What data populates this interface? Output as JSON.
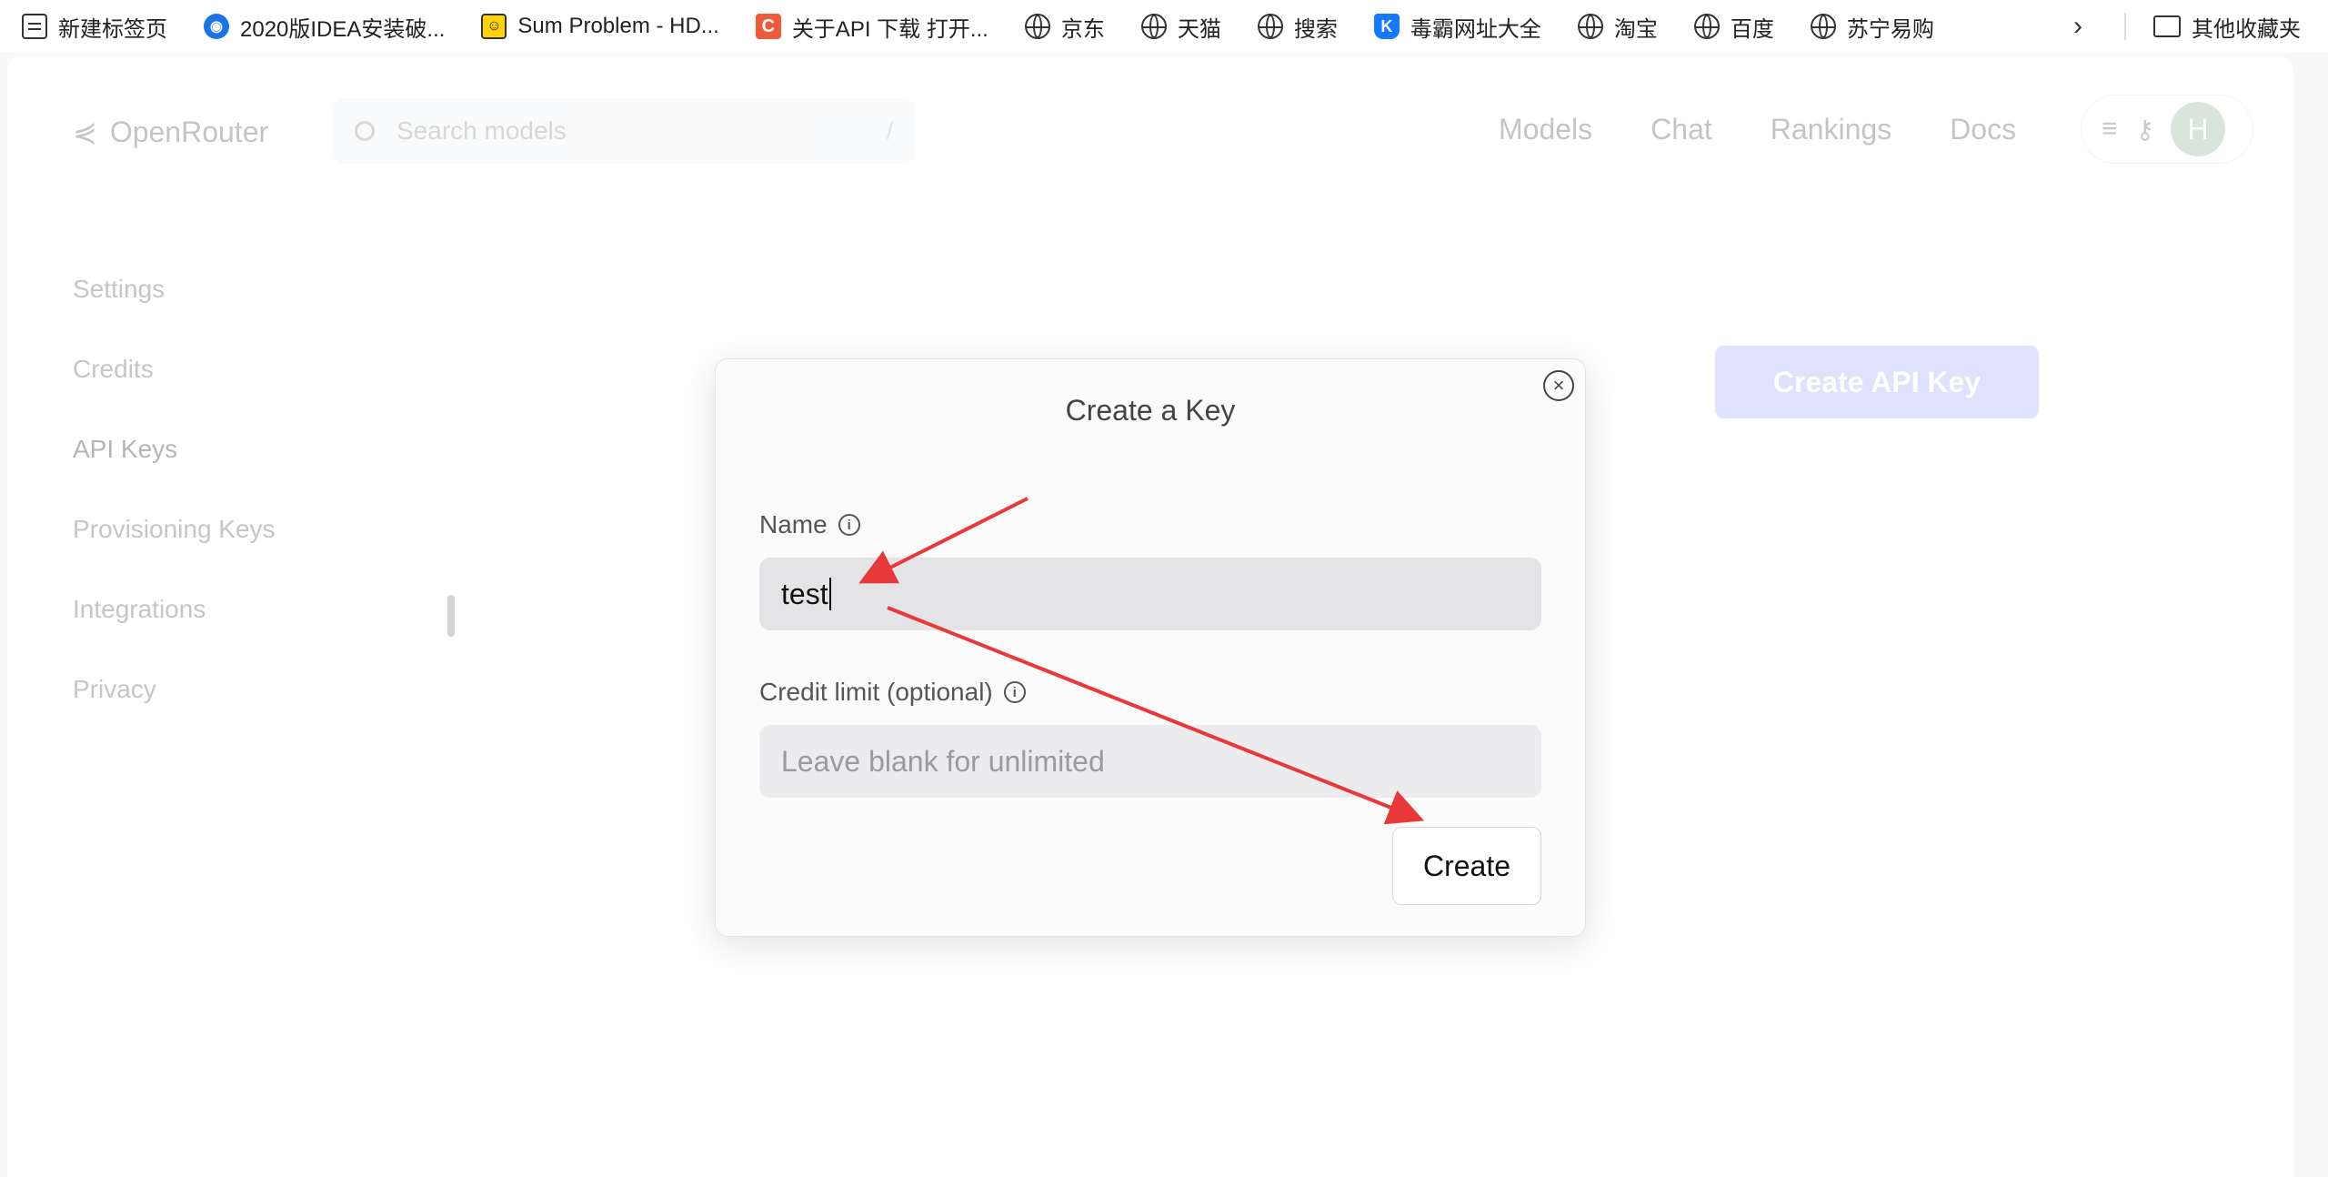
{
  "bookmarks": {
    "items": [
      {
        "label": "新建标签页",
        "icon": "new-tab-icon"
      },
      {
        "label": "2020版IDEA安装破...",
        "icon": "site-icon"
      },
      {
        "label": "Sum Problem - HD...",
        "icon": "smile-icon"
      },
      {
        "label": "关于API 下载 打开...",
        "icon": "c-logo-icon"
      },
      {
        "label": "京东",
        "icon": "globe-icon"
      },
      {
        "label": "天猫",
        "icon": "globe-icon"
      },
      {
        "label": "搜索",
        "icon": "globe-icon"
      },
      {
        "label": "毒霸网址大全",
        "icon": "k-logo-icon"
      },
      {
        "label": "淘宝",
        "icon": "globe-icon"
      },
      {
        "label": "百度",
        "icon": "globe-icon"
      },
      {
        "label": "苏宁易购",
        "icon": "globe-icon"
      }
    ],
    "other_folder": "其他收藏夹"
  },
  "header": {
    "logo": "OpenRouter",
    "search_placeholder": "Search models",
    "search_shortcut": "/",
    "nav": [
      "Models",
      "Chat",
      "Rankings",
      "Docs"
    ],
    "avatar_initial": "H"
  },
  "sidebar": {
    "items": [
      "Settings",
      "Credits",
      "API Keys",
      "Provisioning Keys",
      "Integrations",
      "Privacy"
    ],
    "active": "API Keys"
  },
  "main": {
    "create_api_key_label": "Create API Key"
  },
  "modal": {
    "title": "Create a Key",
    "name_label": "Name",
    "name_value": "test",
    "credit_label": "Credit limit (optional)",
    "credit_placeholder": "Leave blank for unlimited",
    "create_label": "Create"
  },
  "colors": {
    "accent_button": "#cfd3fb",
    "annotation_arrow": "#e8383a",
    "avatar": "#7aa67e"
  }
}
